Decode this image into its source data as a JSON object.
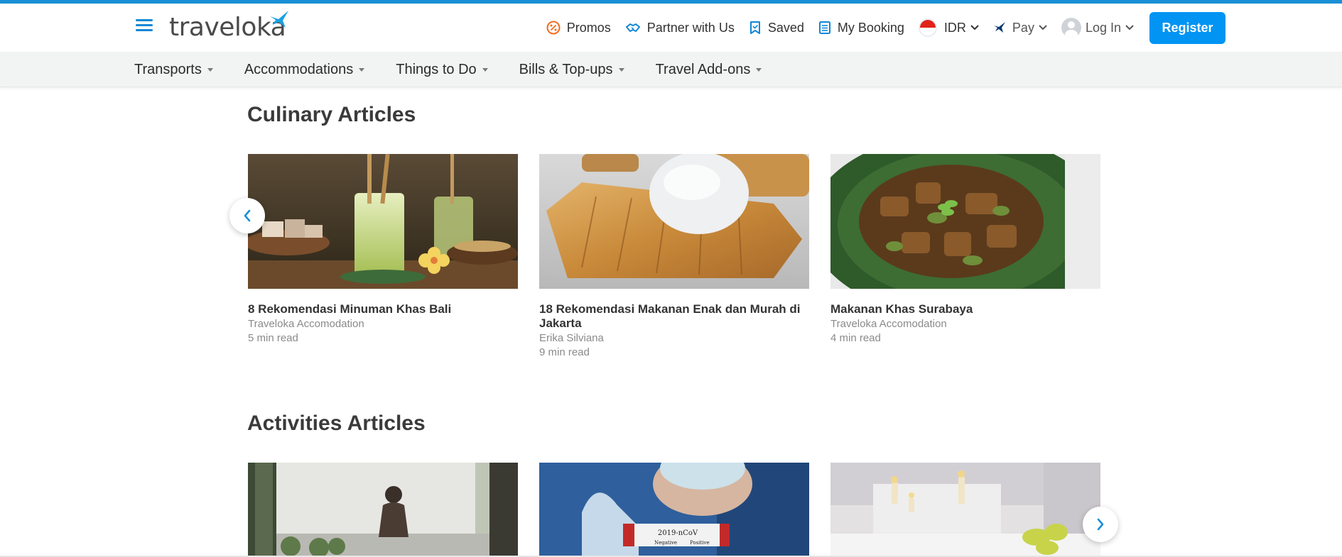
{
  "header": {
    "logo_text": "traveloka",
    "nav": {
      "promos": "Promos",
      "partner": "Partner with Us",
      "saved": "Saved",
      "my_booking": "My Booking",
      "currency": "IDR",
      "pay": "Pay",
      "login": "Log In",
      "register": "Register"
    },
    "accent_color": "#0194f3"
  },
  "subnav": {
    "items": [
      "Transports",
      "Accommodations",
      "Things to Do",
      "Bills & Top-ups",
      "Travel Add-ons"
    ]
  },
  "culinary": {
    "title": "Culinary Articles",
    "cards": [
      {
        "title": "8 Rekomendasi Minuman Khas Bali",
        "author": "Traveloka Accomodation",
        "read": "5 min read"
      },
      {
        "title": "18 Rekomendasi Makanan Enak dan Murah di Jakarta",
        "author": "Erika Silviana",
        "read": "9 min read"
      },
      {
        "title": "Makanan Khas Surabaya",
        "author": "Traveloka Accomodation",
        "read": "4 min read"
      }
    ]
  },
  "activities": {
    "title": "Activities Articles",
    "test_tube_label": "2019-nCoV",
    "test_tube_negative": "Negative",
    "test_tube_positive": "Positive"
  },
  "icons": {
    "menu": "hamburger-menu-icon",
    "promos": "percent-badge-icon",
    "partner": "handshake-icon",
    "saved": "bookmark-icon",
    "booking": "list-document-icon",
    "flag": "indonesia-flag-icon",
    "pay": "traveloka-bird-icon",
    "login": "user-avatar-icon",
    "prev": "chevron-left-icon",
    "next": "chevron-right-icon"
  }
}
